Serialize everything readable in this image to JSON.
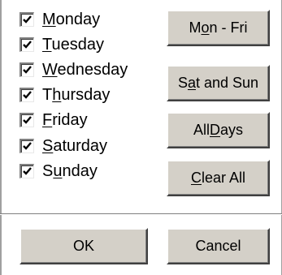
{
  "days": [
    {
      "pre": "",
      "mnemonic": "M",
      "post": "onday",
      "checked": true
    },
    {
      "pre": "",
      "mnemonic": "T",
      "post": "uesday",
      "checked": true
    },
    {
      "pre": "",
      "mnemonic": "W",
      "post": "ednesday",
      "checked": true
    },
    {
      "pre": "T",
      "mnemonic": "h",
      "post": "ursday",
      "checked": true
    },
    {
      "pre": "",
      "mnemonic": "F",
      "post": "riday",
      "checked": true
    },
    {
      "pre": "",
      "mnemonic": "S",
      "post": "aturday",
      "checked": true
    },
    {
      "pre": "S",
      "mnemonic": "u",
      "post": "nday",
      "checked": true
    }
  ],
  "buttons": {
    "mon_fri": {
      "pre": "M",
      "mnemonic": "o",
      "post": "n - Fri"
    },
    "sat_sun": {
      "pre": "S",
      "mnemonic": "a",
      "post": "t and Sun"
    },
    "all_days": {
      "pre": "All ",
      "mnemonic": "D",
      "post": "ays"
    },
    "clear_all": {
      "pre": "",
      "mnemonic": "C",
      "post": "lear All"
    },
    "ok": {
      "label": "OK"
    },
    "cancel": {
      "label": "Cancel"
    }
  },
  "colors": {
    "button_face": "#d4d0c8",
    "background": "#ffffff",
    "check_mark": "#000000"
  },
  "icons": {
    "check": "check-mark-icon"
  }
}
